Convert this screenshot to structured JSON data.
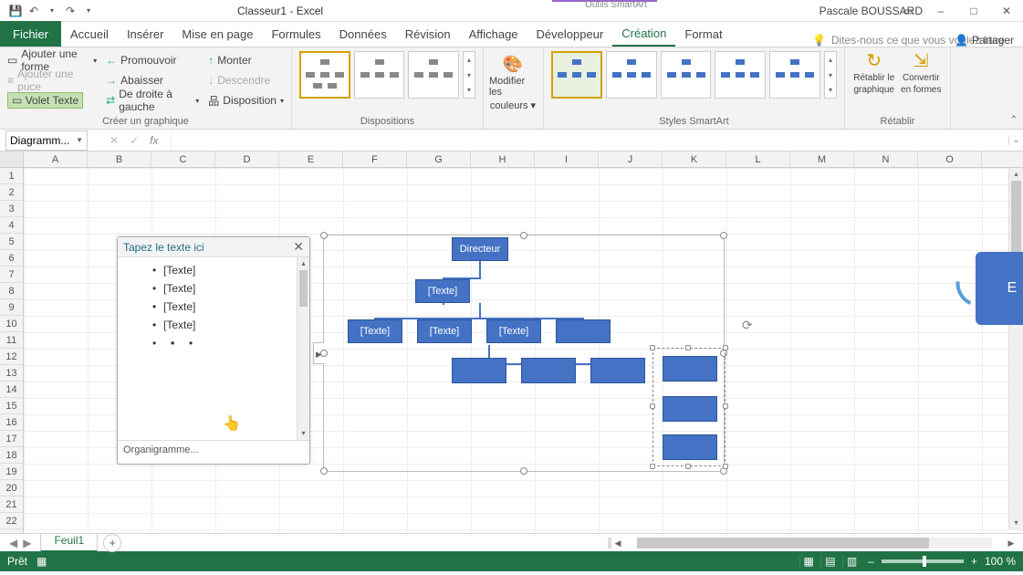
{
  "app": {
    "title": "Classeur1 - Excel",
    "tool_context": "Outils SmartArt",
    "user": "Pascale BOUSSARD"
  },
  "qat": {
    "save": "💾",
    "undo": "↶",
    "redo": "↷"
  },
  "win": {
    "min": "–",
    "max": "□",
    "close": "✕",
    "ribbon_opts": "▭"
  },
  "tabs": {
    "file": "Fichier",
    "items": [
      "Accueil",
      "Insérer",
      "Mise en page",
      "Formules",
      "Données",
      "Révision",
      "Affichage",
      "Développeur",
      "Création",
      "Format"
    ],
    "active": "Création",
    "tellme": "Dites-nous ce que vous voulez faire",
    "share": "Partager"
  },
  "ribbon": {
    "group1": {
      "add_shape": "Ajouter une forme",
      "add_bullet": "Ajouter une puce",
      "text_pane": "Volet Texte",
      "label": "Créer un graphique"
    },
    "group1b": {
      "promote": "Promouvoir",
      "demote": "Abaisser",
      "rtl": "De droite à gauche"
    },
    "group1c": {
      "up": "Monter",
      "down": "Descendre",
      "layout": "Disposition"
    },
    "dispositions_label": "Dispositions",
    "mod_colors": {
      "l1": "Modifier les",
      "l2": "couleurs"
    },
    "styles_label": "Styles SmartArt",
    "reset": {
      "l1": "Rétablir le",
      "l2": "graphique"
    },
    "convert": {
      "l1": "Convertir",
      "l2": "en formes"
    },
    "reset_label": "Rétablir"
  },
  "namebox": "Diagramm...",
  "textpane": {
    "title": "Tapez le texte ici",
    "items": [
      {
        "txt": "[Texte]",
        "ind": 0
      },
      {
        "txt": "[Texte]",
        "ind": 0
      },
      {
        "txt": "[Texte]",
        "ind": 0
      },
      {
        "txt": "[Texte]",
        "ind": 0
      },
      {
        "txt": "",
        "ind": 0
      },
      {
        "txt": "",
        "ind": 1
      },
      {
        "txt": "",
        "ind": 1
      },
      {
        "txt": "",
        "ind": 1
      },
      {
        "txt": "",
        "ind": 1,
        "sel": true
      },
      {
        "txt": "",
        "ind": 2
      }
    ],
    "footer": "Organigramme..."
  },
  "smartart": {
    "boxes": {
      "director": "Directeur",
      "sub1": "[Texte]",
      "r1a": "[Texte]",
      "r1b": "[Texte]",
      "r1c": "[Texte]"
    }
  },
  "sidebadge": "E",
  "cols": [
    "A",
    "B",
    "C",
    "D",
    "E",
    "F",
    "G",
    "H",
    "I",
    "J",
    "K",
    "L",
    "M",
    "N",
    "O"
  ],
  "rows": [
    "1",
    "2",
    "3",
    "4",
    "5",
    "6",
    "7",
    "8",
    "9",
    "10",
    "11",
    "12",
    "13",
    "14",
    "15",
    "16",
    "17",
    "18",
    "19",
    "20",
    "21",
    "22"
  ],
  "sheet": {
    "name": "Feuil1"
  },
  "status": {
    "ready": "Prêt",
    "zoom": "100 %"
  }
}
